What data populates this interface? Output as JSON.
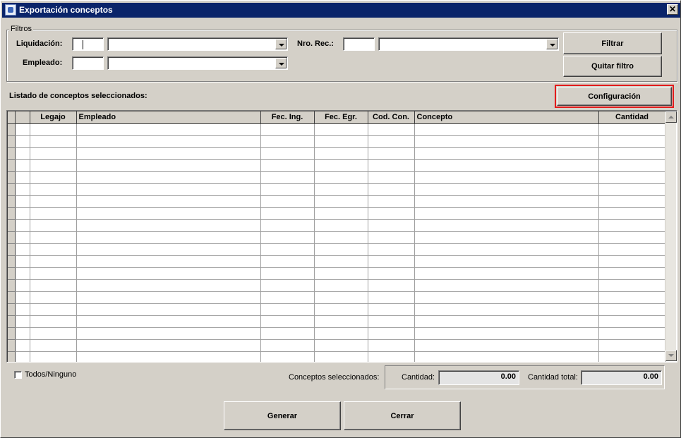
{
  "window": {
    "title": "Exportación conceptos",
    "close_label": "✕"
  },
  "filters": {
    "group_title": "Filtros",
    "liquidacion_label": "Liquidación:",
    "liquidacion_code": "",
    "liquidacion_value": "",
    "empleado_label": "Empleado:",
    "empleado_code": "",
    "empleado_value": "",
    "nro_rec_label": "Nro. Rec.:",
    "nro_rec_code": "",
    "nro_rec_value": "",
    "filtrar_button": "Filtrar",
    "quitar_filtro_button": "Quitar filtro"
  },
  "list": {
    "title": "Listado de conceptos seleccionados:",
    "configuracion_button": "Configuración",
    "columns": [
      "Legajo",
      "Empleado",
      "Fec. Ing.",
      "Fec. Egr.",
      "Cod. Con.",
      "Concepto",
      "Cantidad"
    ],
    "rows": []
  },
  "footer": {
    "todos_label": "Todos/Ninguno",
    "todos_checked": false,
    "conceptos_label": "Conceptos seleccionados:",
    "cantidad_label": "Cantidad:",
    "cantidad_value": "0.00",
    "cantidad_total_label": "Cantidad total:",
    "cantidad_total_value": "0.00",
    "generar_button": "Generar",
    "cerrar_button": "Cerrar"
  }
}
